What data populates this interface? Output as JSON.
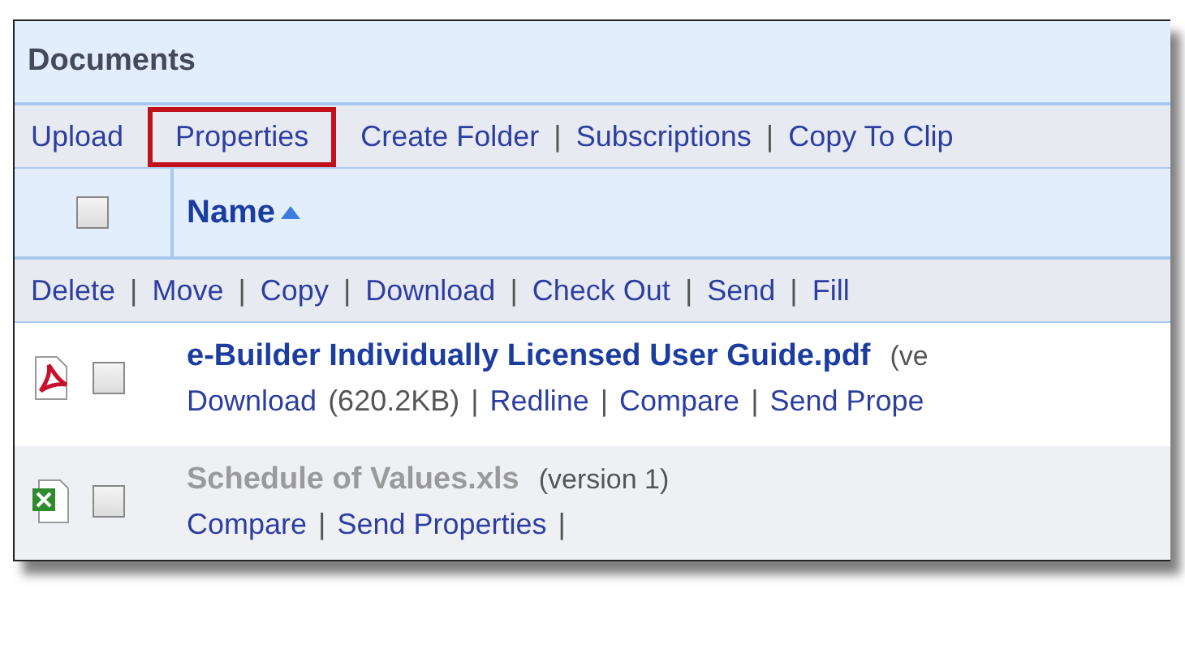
{
  "panel_title": "Documents",
  "toolbar": [
    {
      "kind": "link",
      "text": "Upload"
    },
    {
      "kind": "boxed",
      "text": "Properties"
    },
    {
      "kind": "link",
      "text": "Create Folder"
    },
    {
      "kind": "sep",
      "text": "|"
    },
    {
      "kind": "link",
      "text": "Subscriptions"
    },
    {
      "kind": "sep",
      "text": "|"
    },
    {
      "kind": "link",
      "text": "Copy To Clip"
    }
  ],
  "header": {
    "checked": false,
    "column": "Name",
    "sort_ascending": true
  },
  "actions": [
    {
      "kind": "link",
      "text": "Delete"
    },
    {
      "kind": "sep",
      "text": "|"
    },
    {
      "kind": "link",
      "text": "Move"
    },
    {
      "kind": "sep",
      "text": "|"
    },
    {
      "kind": "link",
      "text": "Copy"
    },
    {
      "kind": "sep",
      "text": "|"
    },
    {
      "kind": "link",
      "text": "Download"
    },
    {
      "kind": "sep",
      "text": "|"
    },
    {
      "kind": "link",
      "text": "Check Out"
    },
    {
      "kind": "sep",
      "text": "|"
    },
    {
      "kind": "link",
      "text": "Send"
    },
    {
      "kind": "sep",
      "text": "|"
    },
    {
      "kind": "link",
      "text": "Fill"
    }
  ],
  "documents": [
    {
      "kind": "pdf",
      "title": "e-Builder Individually Licensed User Guide.pdf",
      "version": "(ve",
      "dimmed": false,
      "checked": false,
      "links": [
        {
          "kind": "link",
          "text": "Download"
        },
        {
          "kind": "note",
          "text": "(620.2KB)"
        },
        {
          "kind": "sep",
          "text": "|"
        },
        {
          "kind": "link",
          "text": "Redline"
        },
        {
          "kind": "sep",
          "text": "|"
        },
        {
          "kind": "link",
          "text": "Compare"
        },
        {
          "kind": "sep",
          "text": "|"
        },
        {
          "kind": "link",
          "text": "Send Prope"
        }
      ]
    },
    {
      "kind": "xls",
      "title": "Schedule of Values.xls",
      "version": "(version 1)",
      "dimmed": true,
      "checked": false,
      "links": [
        {
          "kind": "link",
          "text": "Compare"
        },
        {
          "kind": "sep",
          "text": "|"
        },
        {
          "kind": "link",
          "text": "Send Properties"
        },
        {
          "kind": "sep",
          "text": "|"
        }
      ]
    }
  ]
}
